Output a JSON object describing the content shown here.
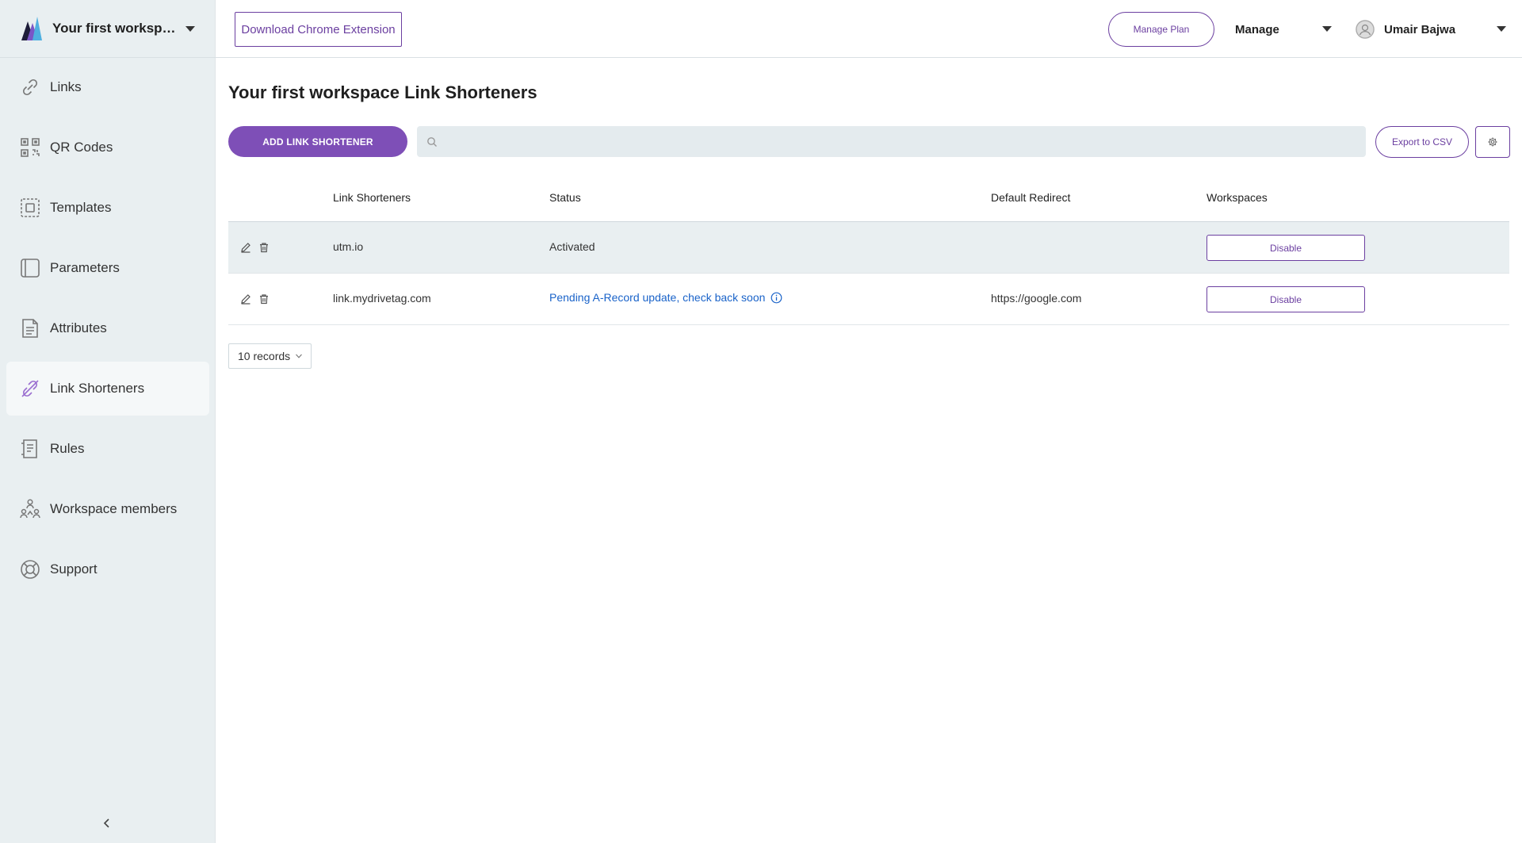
{
  "colors": {
    "accent": "#7e4fb7",
    "accent_dark": "#6b3fa0",
    "sidebar_bg": "#e9eff1",
    "link_blue": "#1a63c9"
  },
  "workspace": {
    "name": "Your first workspa...",
    "logo_icon": "brand-logo-icon"
  },
  "topbar": {
    "chrome_extension_label": "Download Chrome Extension",
    "manage_plan_label": "Manage Plan",
    "manage_label": "Manage",
    "user_name": "Umair Bajwa"
  },
  "sidebar": {
    "items": [
      {
        "label": "Links",
        "icon": "link-icon",
        "active": false
      },
      {
        "label": "QR Codes",
        "icon": "qr-code-icon",
        "active": false
      },
      {
        "label": "Templates",
        "icon": "template-icon",
        "active": false
      },
      {
        "label": "Parameters",
        "icon": "parameters-icon",
        "active": false
      },
      {
        "label": "Attributes",
        "icon": "document-icon",
        "active": false
      },
      {
        "label": "Link Shorteners",
        "icon": "broken-link-icon",
        "active": true
      },
      {
        "label": "Rules",
        "icon": "rules-icon",
        "active": false
      },
      {
        "label": "Workspace members",
        "icon": "members-icon",
        "active": false
      },
      {
        "label": "Support",
        "icon": "lifebuoy-icon",
        "active": false
      }
    ]
  },
  "main": {
    "title": "Your first workspace Link Shorteners",
    "add_button_label": "ADD LINK SHORTENER",
    "search_value": "",
    "search_placeholder": "",
    "export_label": "Export to CSV",
    "table": {
      "columns": [
        "",
        "Link Shorteners",
        "Status",
        "Default Redirect",
        "Workspaces"
      ],
      "rows": [
        {
          "shortener": "utm.io",
          "status": "Activated",
          "status_pending": false,
          "redirect": "",
          "action_label": "Disable"
        },
        {
          "shortener": "link.mydrivetag.com",
          "status": "Pending A-Record update, check back soon",
          "status_pending": true,
          "redirect": "https://google.com",
          "action_label": "Disable"
        }
      ]
    },
    "records_label": "10 records"
  }
}
